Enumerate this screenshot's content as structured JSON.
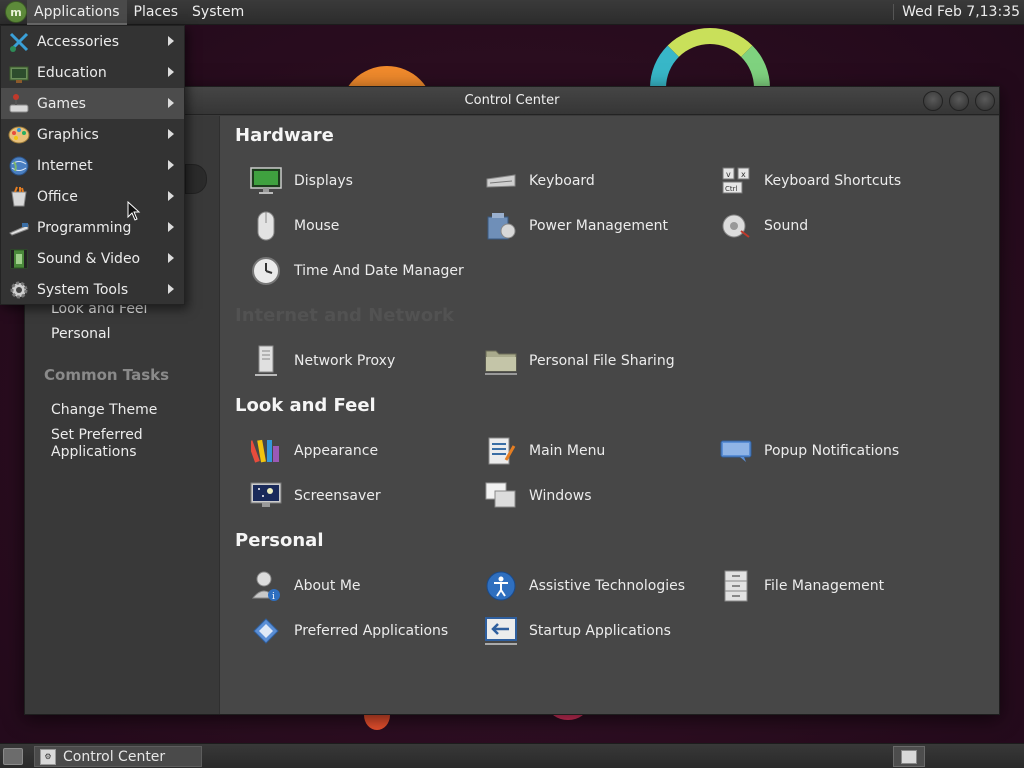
{
  "top_panel": {
    "menus": [
      "Applications",
      "Places",
      "System"
    ],
    "clock": "Wed Feb  7,13:35"
  },
  "app_menu": {
    "items": [
      {
        "label": "Accessories",
        "icon": "accessories-icon"
      },
      {
        "label": "Education",
        "icon": "education-icon"
      },
      {
        "label": "Games",
        "icon": "games-icon"
      },
      {
        "label": "Graphics",
        "icon": "graphics-icon"
      },
      {
        "label": "Internet",
        "icon": "internet-icon"
      },
      {
        "label": "Office",
        "icon": "office-icon"
      },
      {
        "label": "Programming",
        "icon": "programming-icon"
      },
      {
        "label": "Sound & Video",
        "icon": "sound-video-icon"
      },
      {
        "label": "System Tools",
        "icon": "system-tools-icon"
      }
    ],
    "hovered": "Games"
  },
  "window": {
    "title": "Control Center",
    "sidebar": {
      "groups": [
        "Look and Feel",
        "Personal"
      ],
      "common_tasks_heading": "Common Tasks",
      "tasks": [
        "Change Theme",
        "Set Preferred",
        "Applications"
      ]
    },
    "sections": {
      "hardware": {
        "title": "Hardware",
        "items": [
          "Displays",
          "Keyboard",
          "Keyboard Shortcuts",
          "Mouse",
          "Power Management",
          "Sound",
          "Time And Date Manager"
        ]
      },
      "internet": {
        "title": "Internet and Network",
        "items": [
          "Network Proxy",
          "Personal File Sharing"
        ]
      },
      "look": {
        "title": "Look and Feel",
        "items": [
          "Appearance",
          "Main Menu",
          "Popup Notifications",
          "Screensaver",
          "Windows"
        ]
      },
      "personal": {
        "title": "Personal",
        "items": [
          "About Me",
          "Assistive Technologies",
          "File Management",
          "Preferred Applications",
          "Startup Applications"
        ]
      }
    }
  },
  "bottom_panel": {
    "task_label": "Control Center"
  },
  "colors": {
    "panel": "#2c2c2c",
    "window_content": "#474747",
    "sidebar": "#393939",
    "menu_hover": "#4c4c4c",
    "accent_green": "#5d8a3a"
  }
}
